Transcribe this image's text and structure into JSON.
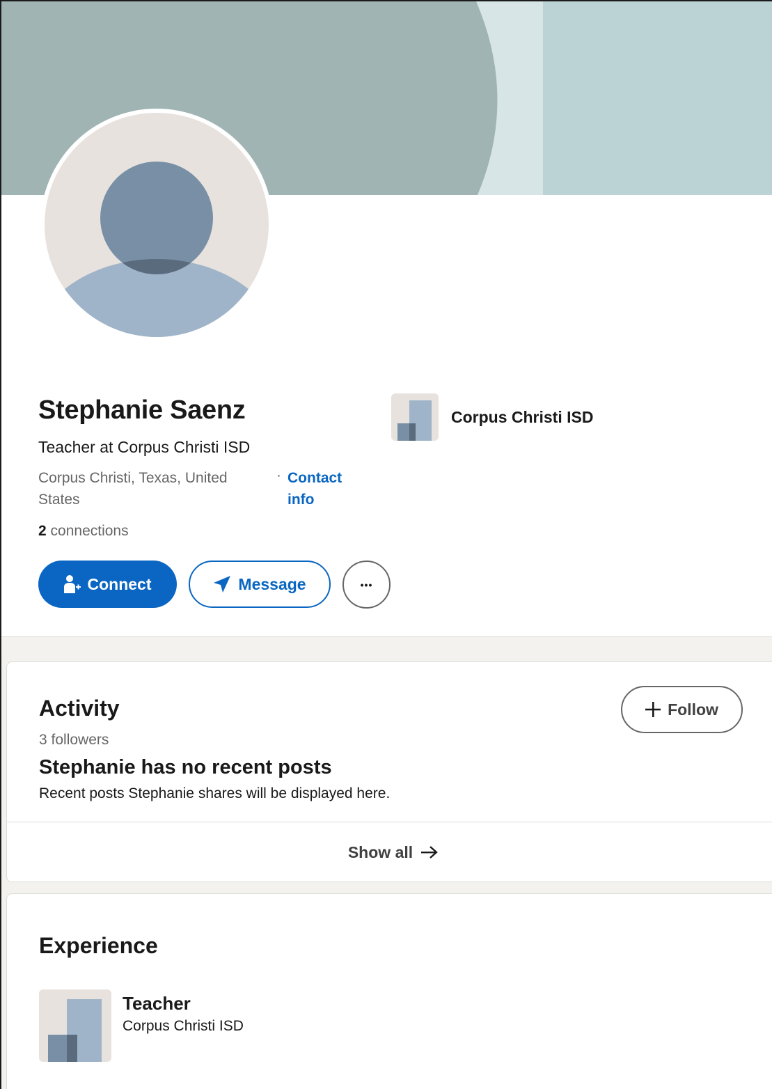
{
  "profile": {
    "name": "Stephanie Saenz",
    "headline": "Teacher at Corpus Christi ISD",
    "location": "Corpus Christi, Texas, United States",
    "contact_separator": "·",
    "contact_info_label": "Contact info",
    "connections_count": "2",
    "connections_label": "connections",
    "current_company": "Corpus Christi ISD"
  },
  "actions": {
    "connect_label": "Connect",
    "message_label": "Message",
    "more_label": "•••"
  },
  "activity": {
    "title": "Activity",
    "followers": "3 followers",
    "follow_label": "Follow",
    "empty_title": "Stephanie has no recent posts",
    "empty_subtitle": "Recent posts Stephanie shares will be displayed here.",
    "show_all_label": "Show all"
  },
  "experience": {
    "title": "Experience",
    "items": [
      {
        "role": "Teacher",
        "company": "Corpus Christi ISD"
      }
    ]
  },
  "colors": {
    "accent": "#0a66c2",
    "banner_left": "#a0b4b3",
    "banner_mid": "#d7e5e6",
    "banner_right": "#bcd3d5",
    "avatar_bg": "#e7e2de",
    "avatar_head": "#788fa5",
    "avatar_body": "#9fb4c9"
  },
  "icons": {
    "connect": "person-add-icon",
    "message": "send-icon",
    "more": "ellipsis-icon",
    "follow": "plus-icon",
    "show_all": "arrow-right-icon"
  }
}
